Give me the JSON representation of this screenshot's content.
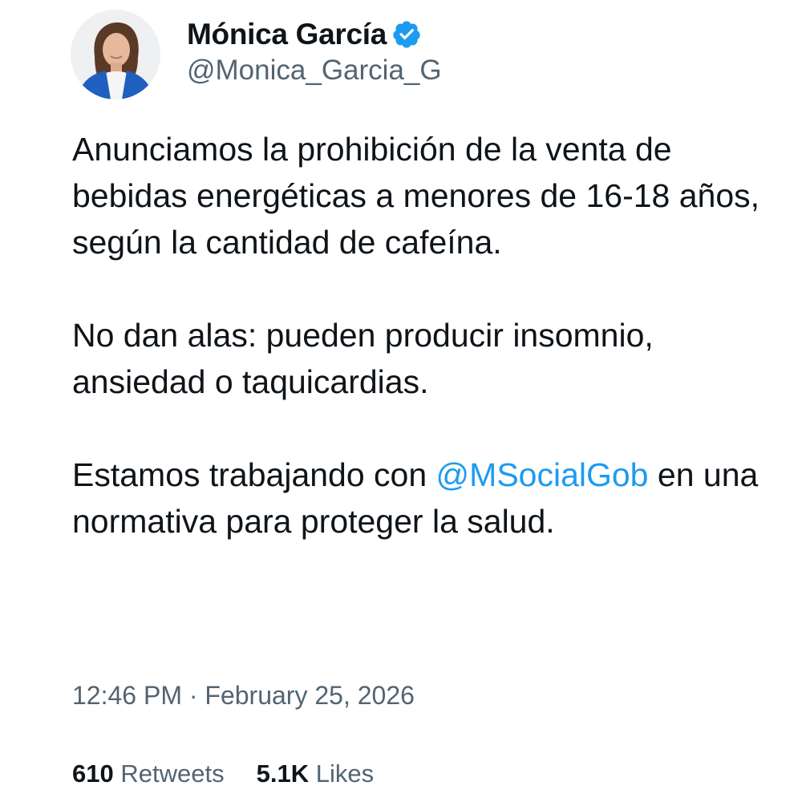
{
  "author": {
    "display_name": "Mónica García",
    "handle": "@Monica_Garcia_G",
    "verified": true,
    "avatar_icon": "profile-photo"
  },
  "tweet": {
    "paragraphs": [
      {
        "text_before": "Anunciamos la prohibición de la venta de bebidas energéticas a menores de 16-18 años, según la cantidad de cafeína.",
        "mention": "",
        "text_after": ""
      },
      {
        "text_before": "No dan alas: pueden producir insomnio, ansiedad o taquicardias.",
        "mention": "",
        "text_after": ""
      },
      {
        "text_before": "Estamos trabajando con ",
        "mention": "@MSocialGob",
        "text_after": " en una normativa para proteger la salud."
      }
    ],
    "time": "12:46 PM",
    "separator": "·",
    "date": "February 25, 2026"
  },
  "stats": {
    "retweets_count": "610",
    "retweets_label": "Retweets",
    "likes_count": "5.1K",
    "likes_label": "Likes"
  },
  "colors": {
    "text": "#0f1419",
    "secondary": "#536471",
    "accent": "#1d9bf0",
    "verified_badge": "#1d9bf0"
  }
}
